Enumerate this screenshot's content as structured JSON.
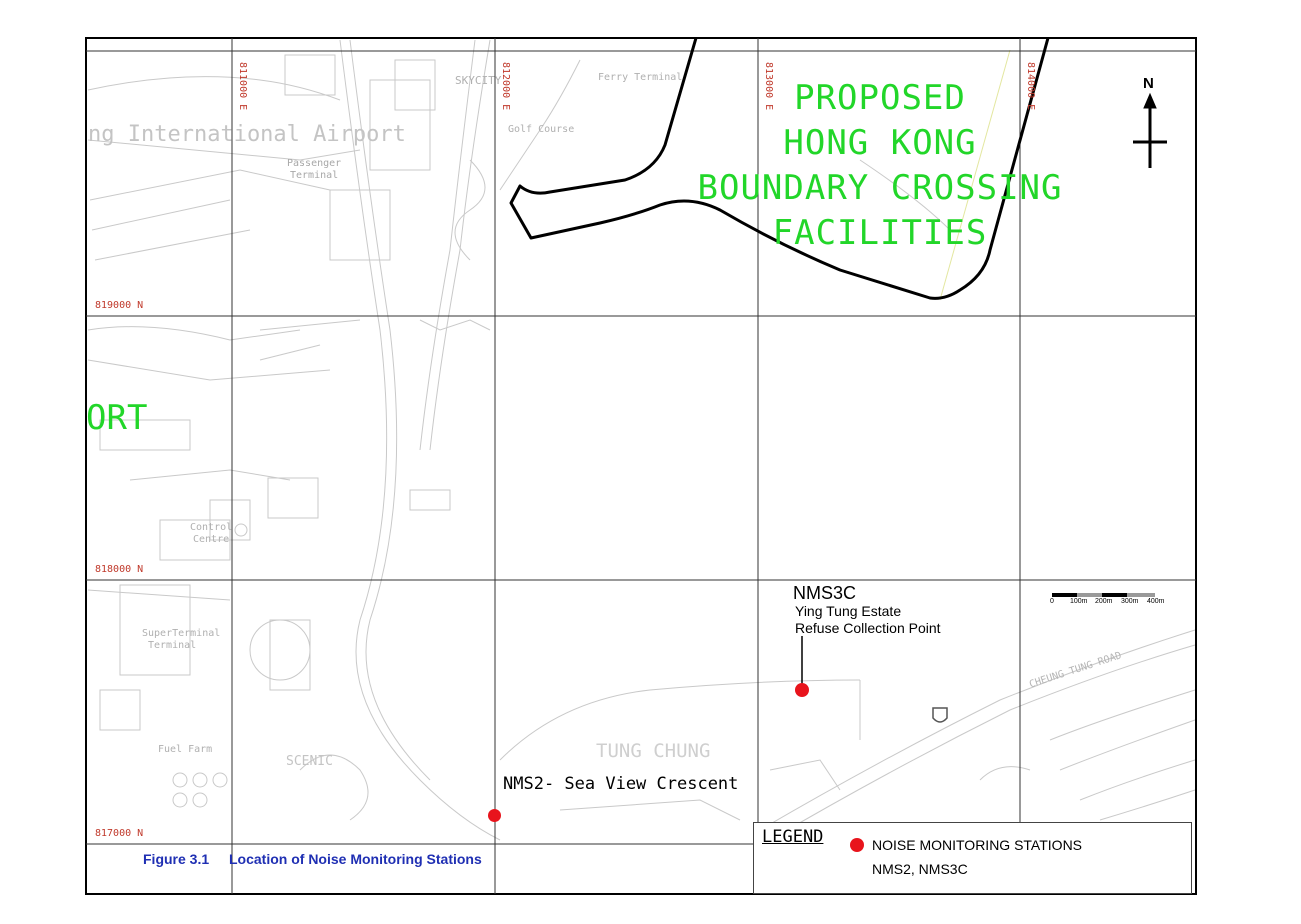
{
  "figure": {
    "number": "Figure 3.1",
    "title": "Location of Noise Monitoring Stations",
    "title_color": "#1f2fb3"
  },
  "grid": {
    "eastings": [
      "811000 E",
      "812000 E",
      "813000 E",
      "814000 E"
    ],
    "northings": [
      "819000 N",
      "818000 N",
      "817000 N"
    ],
    "label_color": "#c0392b"
  },
  "proposed_facility": {
    "lines": [
      "PROPOSED",
      "HONG KONG",
      "BOUNDARY CROSSING",
      "FACILITIES"
    ],
    "color": "#22d629"
  },
  "partial_airport_label": "ORT",
  "north_arrow": {
    "label": "N"
  },
  "scale_bar": {
    "labels": [
      "0",
      "100m",
      "200m",
      "300m",
      "400m"
    ]
  },
  "stations": [
    {
      "id": "NMS3C",
      "description_lines": [
        "Ying Tung Estate",
        "Refuse Collection Point"
      ]
    },
    {
      "id": "NMS2",
      "label": "NMS2- Sea View Crescent"
    }
  ],
  "legend": {
    "title": "LEGEND",
    "symbol_label": "NOISE MONITORING STATIONS",
    "stations_list": "NMS2, NMS3C",
    "dot_color": "#e8141c"
  },
  "base_map_labels": {
    "airport": "ng International Airport",
    "passenger_terminal": [
      "Passenger",
      "Terminal"
    ],
    "skycity": "SKYCITY",
    "ferry_terminal": "Ferry Terminal",
    "golf_course": "Golf Course",
    "superterminal": [
      "SuperTerminal",
      "Terminal"
    ],
    "scenic": "SCENIC",
    "tung_chung": "TUNG CHUNG",
    "cheung_tung_road": "CHEUNG TUNG ROAD",
    "fuel_farm": "Fuel Farm",
    "control_centre": [
      "Control",
      "Centre"
    ]
  }
}
